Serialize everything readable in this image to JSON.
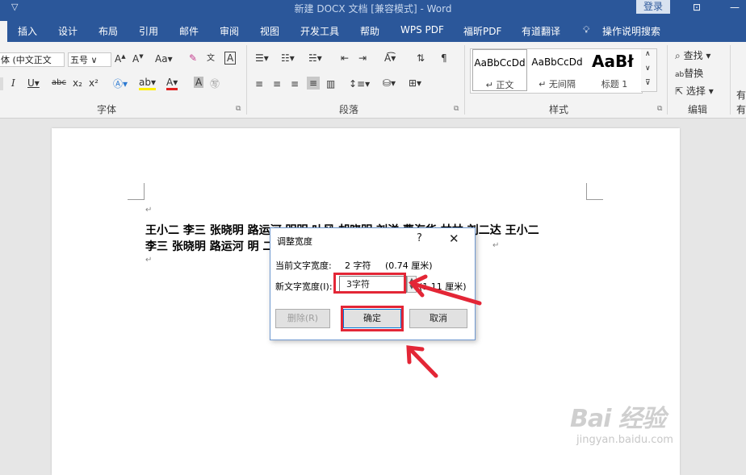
{
  "window": {
    "title": "新建 DOCX 文档 [兼容模式] - Word",
    "login_label": "登录"
  },
  "tabs": [
    "插入",
    "设计",
    "布局",
    "引用",
    "邮件",
    "审阅",
    "视图",
    "开发工具",
    "帮助",
    "WPS PDF",
    "福昕PDF",
    "有道翻译",
    "操作说明搜索"
  ],
  "ribbon": {
    "font_name": "体 (中文正文",
    "font_size": "五号",
    "groups": {
      "font": "字体",
      "paragraph": "段落",
      "styles": "样式",
      "editing": "编辑"
    },
    "styles": [
      {
        "sample": "AaBbCcDd",
        "name": "正文"
      },
      {
        "sample": "AaBbCcDd",
        "name": "无间隔"
      },
      {
        "sample": "AaBł",
        "name": "标题 1"
      }
    ],
    "editing": {
      "find": "查找",
      "replace": "替换",
      "select": "选择"
    },
    "right_cut": [
      "有",
      "有"
    ]
  },
  "document": {
    "line1": "王小二  李三  张晓明    路运河   明明  叶风  胡晓明  刘洋   曹海华  林林  刘二达  王小二",
    "line2": "李三  张晓明    路运河    明                                                             二达"
  },
  "dialog": {
    "title": "调整宽度",
    "help": "?",
    "close": "✕",
    "current_label": "当前文字宽度:",
    "current_value": "2 字符",
    "current_cm": "(0.74 厘米)",
    "new_label": "新文字宽度(I):",
    "new_value": "3字符",
    "new_cm": "(1.11 厘米)",
    "delete_label": "删除(R)",
    "ok_label": "确定",
    "cancel_label": "取消"
  },
  "watermark": {
    "logo": "Bai 经验",
    "url": "jingyan.baidu.com"
  },
  "colors": {
    "accent": "#2b579a",
    "highlight": "#e32636"
  }
}
